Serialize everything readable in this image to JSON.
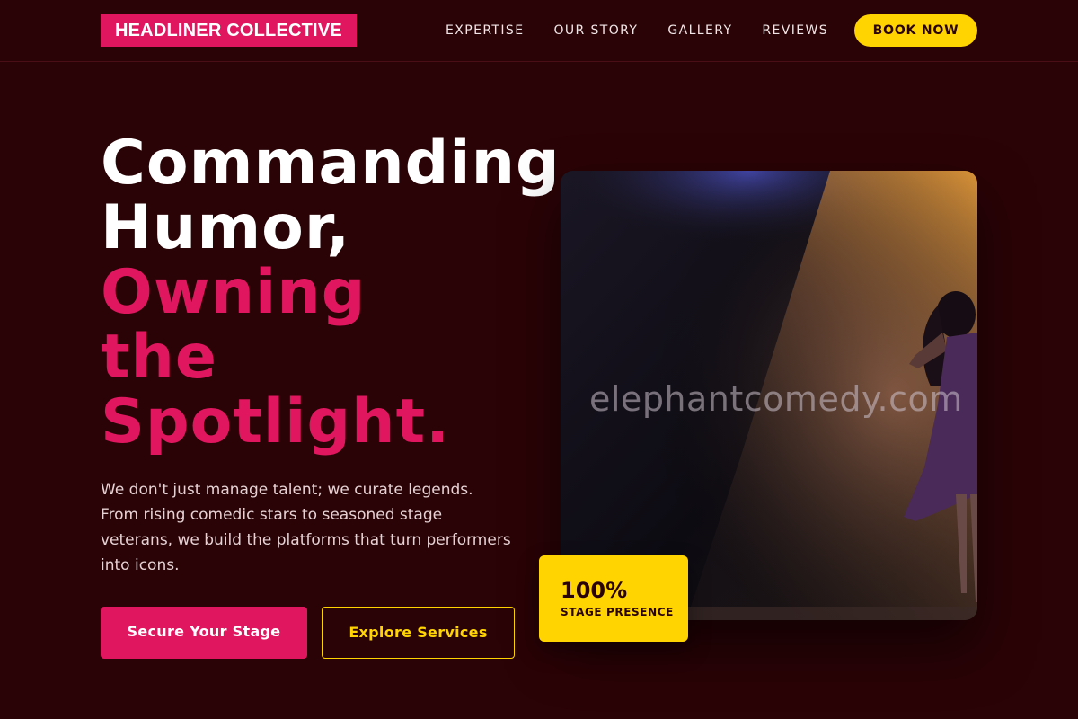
{
  "header": {
    "logo": "HEADLINER COLLECTIVE",
    "nav": [
      "EXPERTISE",
      "OUR STORY",
      "GALLERY",
      "REVIEWS"
    ],
    "cta": "BOOK NOW"
  },
  "hero": {
    "headline_line1": "Commanding",
    "headline_line2": "Humor,",
    "headline_accent1": "Owning",
    "headline_accent2": "the",
    "headline_accent3": "Spotlight.",
    "lede": "We don't just manage talent; we curate legends. From rising comedic stars to seasoned stage veterans, we build the platforms that turn performers into icons.",
    "primary_cta": "Secure Your Stage",
    "secondary_cta": "Explore Services",
    "image_watermark": "elephantcomedy.com",
    "stat_value": "100%",
    "stat_label": "STAGE PRESENCE"
  },
  "colors": {
    "background": "#2a0306",
    "accent_pink": "#e0175f",
    "accent_yellow": "#ffd400"
  }
}
